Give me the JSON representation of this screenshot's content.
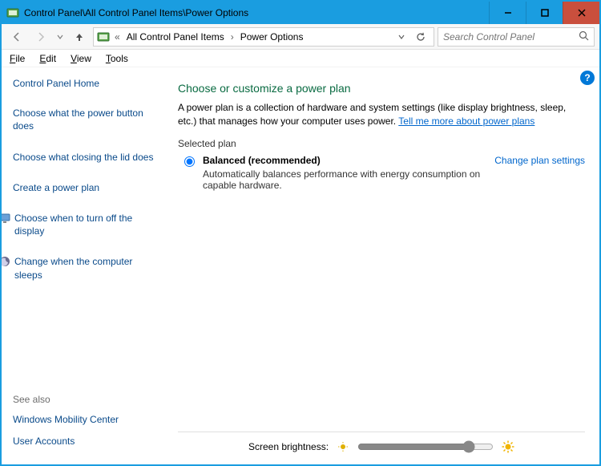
{
  "window": {
    "title": "Control Panel\\All Control Panel Items\\Power Options"
  },
  "breadcrumb": {
    "prefix": "«",
    "item1": "All Control Panel Items",
    "item2": "Power Options"
  },
  "search": {
    "placeholder": "Search Control Panel"
  },
  "menu": {
    "file": "File",
    "edit": "Edit",
    "view": "View",
    "tools": "Tools"
  },
  "sidebar": {
    "home": "Control Panel Home",
    "links": [
      "Choose what the power button does",
      "Choose what closing the lid does",
      "Create a power plan",
      "Choose when to turn off the display",
      "Change when the computer sleeps"
    ],
    "see_also_label": "See also",
    "see_also": [
      "Windows Mobility Center",
      "User Accounts"
    ]
  },
  "content": {
    "heading": "Choose or customize a power plan",
    "description_pre": "A power plan is a collection of hardware and system settings (like display brightness, sleep, etc.) that manages how your computer uses power. ",
    "description_link": "Tell me more about power plans",
    "selected_plan_label": "Selected plan",
    "plan": {
      "name": "Balanced (recommended)",
      "desc": "Automatically balances performance with energy consumption on capable hardware.",
      "change_link": "Change plan settings"
    },
    "brightness_label": "Screen brightness:",
    "brightness_value": 85
  },
  "help_icon": "?"
}
